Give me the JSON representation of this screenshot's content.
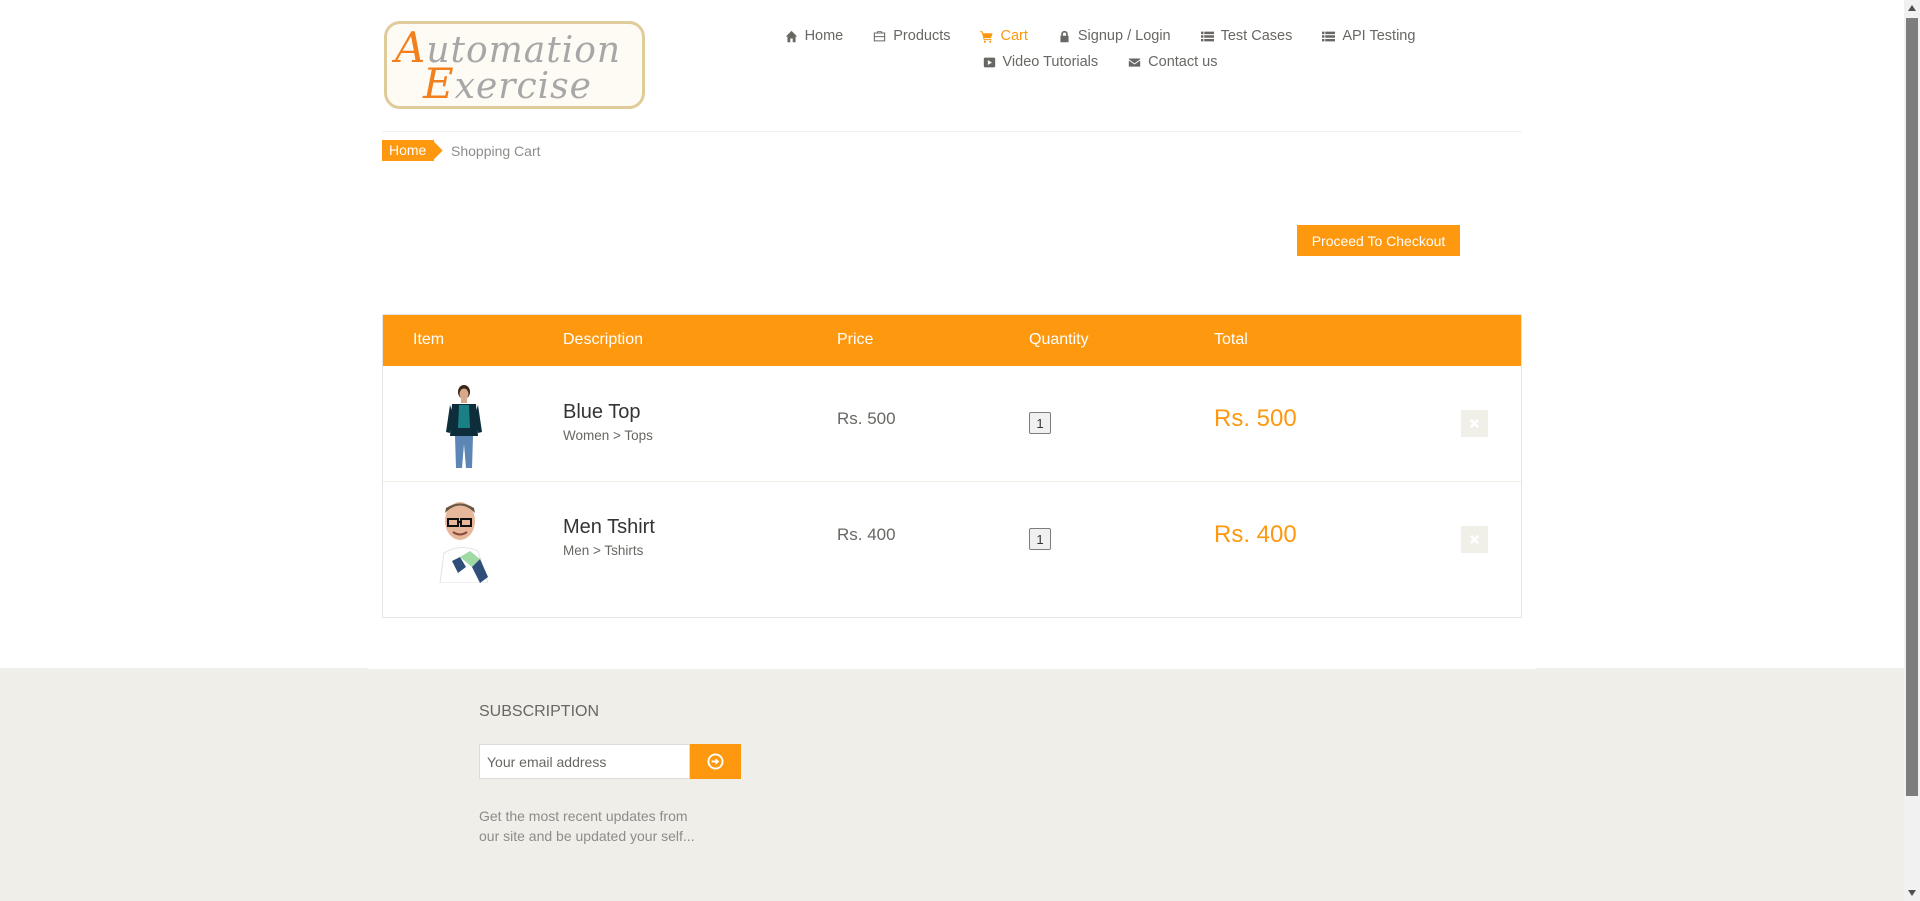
{
  "logo": {
    "line1_cap": "A",
    "line1_rest": "utomation",
    "line2_cap": "E",
    "line2_rest": "xercise"
  },
  "nav": {
    "home": "Home",
    "products": "Products",
    "cart": "Cart",
    "signup": "Signup / Login",
    "test_cases": "Test Cases",
    "api_testing": "API Testing",
    "video_tutorials": "Video Tutorials",
    "contact": "Contact us"
  },
  "breadcrumb": {
    "home": "Home",
    "current": "Shopping Cart"
  },
  "checkout_label": "Proceed To Checkout",
  "cart": {
    "headers": {
      "item": "Item",
      "description": "Description",
      "price": "Price",
      "quantity": "Quantity",
      "total": "Total"
    },
    "rows": [
      {
        "name": "Blue Top",
        "category": "Women > Tops",
        "price": "Rs. 500",
        "quantity": "1",
        "total": "Rs. 500"
      },
      {
        "name": "Men Tshirt",
        "category": "Men > Tshirts",
        "price": "Rs. 400",
        "quantity": "1",
        "total": "Rs. 400"
      }
    ]
  },
  "footer": {
    "subscription_title": "SUBSCRIPTION",
    "email_placeholder": "Your email address",
    "subscription_text": "Get the most recent updates from our site and be updated your self..."
  },
  "colors": {
    "accent": "#fe980f",
    "footer_bg": "#efeee9"
  }
}
